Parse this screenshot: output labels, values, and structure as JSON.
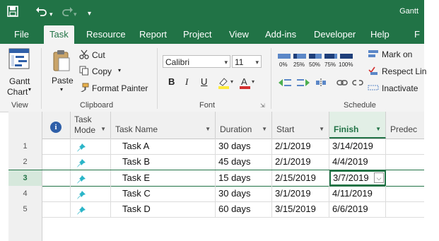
{
  "title_fragment": "Gantt",
  "tabs": [
    "File",
    "Task",
    "Resource",
    "Report",
    "Project",
    "View",
    "Add-ins",
    "Developer",
    "Help",
    "F"
  ],
  "ribbon": {
    "view": {
      "gantt_label_line1": "Gantt",
      "gantt_label_line2": "Chart",
      "group": "View"
    },
    "clipboard": {
      "paste": "Paste",
      "cut": "Cut",
      "copy": "Copy",
      "format_painter": "Format Painter",
      "group": "Clipboard"
    },
    "font": {
      "family": "Calibri",
      "size": "11",
      "bold": "B",
      "italic": "I",
      "underline": "U",
      "group": "Font"
    },
    "schedule": {
      "percents": [
        "0%",
        "25%",
        "50%",
        "75%",
        "100%"
      ],
      "mark_on": "Mark on",
      "respect_links": "Respect Lin",
      "inactivate": "Inactivate",
      "group": "Schedule"
    }
  },
  "grid": {
    "headers": {
      "info": "i",
      "mode_line1": "Task",
      "mode_line2": "Mode",
      "name": "Task Name",
      "duration": "Duration",
      "start": "Start",
      "finish": "Finish",
      "predecessors": "Predec"
    },
    "rows": [
      {
        "num": "1",
        "name": "Task A",
        "duration": "30 days",
        "start": "2/1/2019",
        "finish": "3/14/2019"
      },
      {
        "num": "2",
        "name": "Task B",
        "duration": "45 days",
        "start": "2/1/2019",
        "finish": "4/4/2019"
      },
      {
        "num": "3",
        "name": "Task E",
        "duration": "15 days",
        "start": "2/15/2019",
        "finish": "3/7/2019"
      },
      {
        "num": "4",
        "name": "Task C",
        "duration": "30 days",
        "start": "3/1/2019",
        "finish": "4/11/2019"
      },
      {
        "num": "5",
        "name": "Task D",
        "duration": "60 days",
        "start": "3/15/2019",
        "finish": "6/6/2019"
      }
    ]
  },
  "colors": {
    "accent": "#217346",
    "pin": "#2ab5c8",
    "font_red": "#d32f2f",
    "highlight_yellow": "#ffeb3b"
  }
}
